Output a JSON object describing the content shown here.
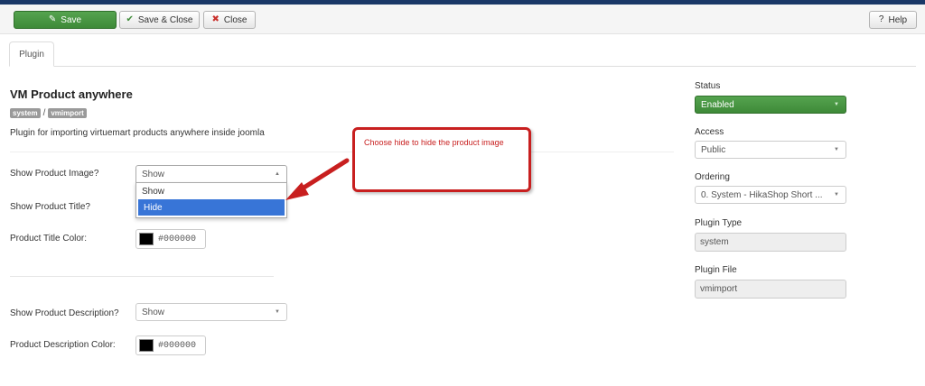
{
  "toolbar": {
    "save_label": "Save",
    "save_close_label": "Save & Close",
    "close_label": "Close",
    "help_label": "Help"
  },
  "tabs": [
    {
      "label": "Plugin"
    }
  ],
  "plugin": {
    "title": "VM Product anywhere",
    "tags": [
      "system",
      "vmimport"
    ],
    "tag_separator": "/",
    "description": "Plugin for importing virtuemart products anywhere inside joomla"
  },
  "fields": {
    "show_image": {
      "label": "Show Product Image?",
      "value": "Show",
      "options": [
        "Show",
        "Hide"
      ],
      "highlighted_option": "Hide"
    },
    "show_title": {
      "label": "Show Product Title?"
    },
    "title_color": {
      "label": "Product Title Color:",
      "value": "#000000"
    },
    "show_description": {
      "label": "Show Product Description?",
      "value": "Show"
    },
    "description_color": {
      "label": "Product Description Color:",
      "value": "#000000"
    }
  },
  "annotation": {
    "text": "Choose hide to hide the product image",
    "color": "#c81f1f"
  },
  "sidebar": {
    "status": {
      "label": "Status",
      "value": "Enabled"
    },
    "access": {
      "label": "Access",
      "value": "Public"
    },
    "ordering": {
      "label": "Ordering",
      "value": "0. System - HikaShop Short ..."
    },
    "plugin_type": {
      "label": "Plugin Type",
      "value": "system"
    },
    "plugin_file": {
      "label": "Plugin File",
      "value": "vmimport"
    }
  },
  "colors": {
    "accent_green": "#46963f",
    "topbar": "#1a3867",
    "highlight_blue": "#3875d7"
  }
}
